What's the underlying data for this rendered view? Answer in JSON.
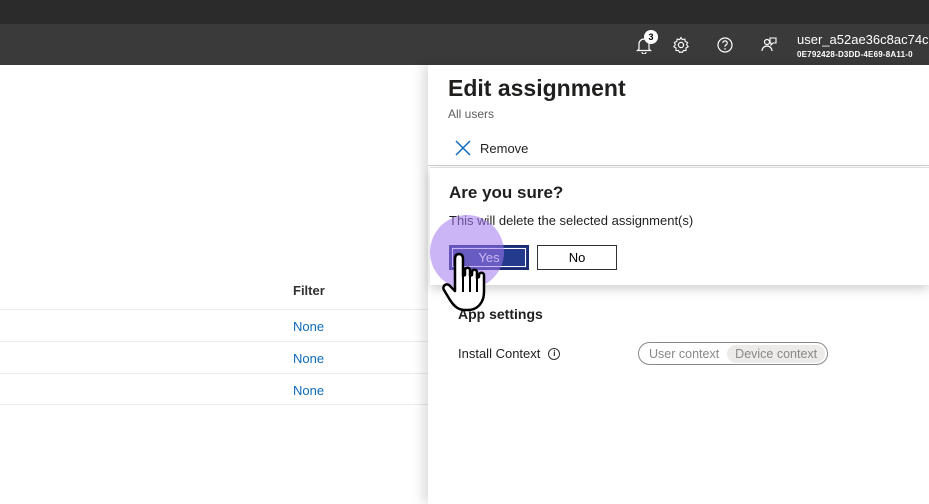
{
  "header": {
    "notification_count": "3",
    "user_name": "user_a52ae36c8ac74c",
    "tenant_id": "0E792428-D3DD-4E69-8A11-0"
  },
  "table": {
    "filter_header": "Filter",
    "rows": [
      {
        "filter": "None"
      },
      {
        "filter": "None"
      },
      {
        "filter": "None"
      }
    ]
  },
  "blade": {
    "title": "Edit assignment",
    "subtitle": "All users",
    "remove_label": "Remove",
    "app_settings_title": "App settings",
    "install_context_label": "Install Context",
    "install_context_options": [
      "User context",
      "Device context"
    ],
    "install_context_selected": "Device context"
  },
  "dialog": {
    "title": "Are you sure?",
    "message": "This will delete the selected assignment(s)",
    "yes_label": "Yes",
    "no_label": "No"
  },
  "colors": {
    "topbar": "#3a3a3a",
    "link": "#0f6cbd",
    "primary_button": "#243a8c",
    "click_highlight": "#a078f0"
  }
}
